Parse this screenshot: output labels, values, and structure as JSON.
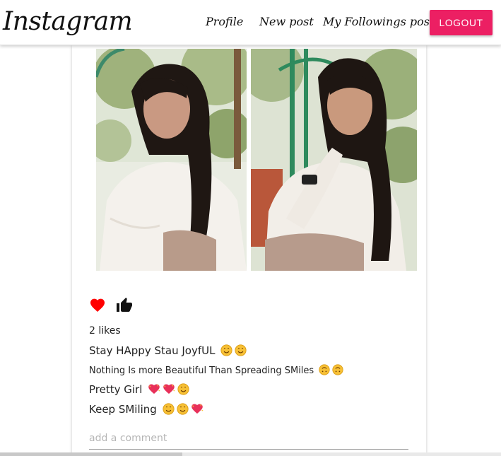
{
  "navbar": {
    "brand": "Instagram",
    "links": {
      "profile": "Profile",
      "new_post": "New post",
      "followings": "My Followings post"
    },
    "logout_label": "LOGOUT",
    "accent_color": "#ec1f63"
  },
  "post": {
    "likes": "2 likes",
    "title": "Stay HAppy Stau JoyfUL",
    "body": "Nothing Is more Beautiful Than Spreading SMiles",
    "comments": [
      {
        "text": "Pretty Girl"
      },
      {
        "text": "Keep SMiling"
      }
    ],
    "comment_placeholder": "add a comment",
    "icons": {
      "like": "heart-icon",
      "thumb": "thumbs-up-icon"
    },
    "heart_color": "#ff0000"
  }
}
